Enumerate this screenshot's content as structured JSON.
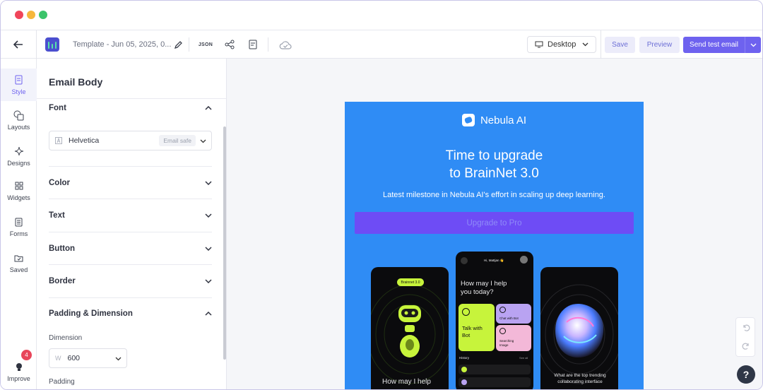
{
  "window": {
    "controls": {
      "close_color": "#f0455a",
      "minimize_color": "#f6b73c",
      "maximize_color": "#3bc46b"
    }
  },
  "toolbar": {
    "template_name": "Template - Jun 05, 2025, 0...",
    "json_label": "JSON",
    "device": "Desktop",
    "save_label": "Save",
    "preview_label": "Preview",
    "send_label": "Send test email",
    "accent": "#6e62ef"
  },
  "leftnav": {
    "items": [
      {
        "label": "Style",
        "icon": "file-icon"
      },
      {
        "label": "Layouts",
        "icon": "layers-icon"
      },
      {
        "label": "Designs",
        "icon": "sparkle-icon"
      },
      {
        "label": "Widgets",
        "icon": "grid-icon"
      },
      {
        "label": "Forms",
        "icon": "form-icon"
      },
      {
        "label": "Saved",
        "icon": "folder-icon"
      }
    ],
    "improve_label": "Improve",
    "improve_badge": "4"
  },
  "panel": {
    "title": "Email Body",
    "sections": [
      {
        "label": "Font",
        "expanded": true
      },
      {
        "label": "Color",
        "expanded": false
      },
      {
        "label": "Text",
        "expanded": false
      },
      {
        "label": "Button",
        "expanded": false
      },
      {
        "label": "Border",
        "expanded": false
      },
      {
        "label": "Padding & Dimension",
        "expanded": true
      }
    ],
    "font_value": "Helvetica",
    "font_badge": "Email safe",
    "dimension_label": "Dimension",
    "dimension_prefix": "W",
    "dimension_value": "600",
    "padding_label": "Padding"
  },
  "email": {
    "background": "#2f8cf5",
    "brand": "Nebula AI",
    "headline_line1": "Time to upgrade",
    "headline_line2": "to BrainNet 3.0",
    "subline": "Latest milestone in Nebula AI's effort in scaling up deep learning.",
    "cta": "Upgrade to Pro",
    "phone_left": {
      "badge": "Brainnet 3.0",
      "bottom_text": "How may I help"
    },
    "phone_mid": {
      "greeting": "Hi, Mattjan 👋",
      "question": "How may I help you today?",
      "tile_1": "Talk with Bot",
      "tile_2": "Chat with Bot",
      "tile_3": "Searching Image",
      "history_label": "History",
      "see_all": "See all"
    },
    "phone_right": {
      "bottom_text": "What are the top trending collaborating interface"
    }
  },
  "help_label": "?"
}
